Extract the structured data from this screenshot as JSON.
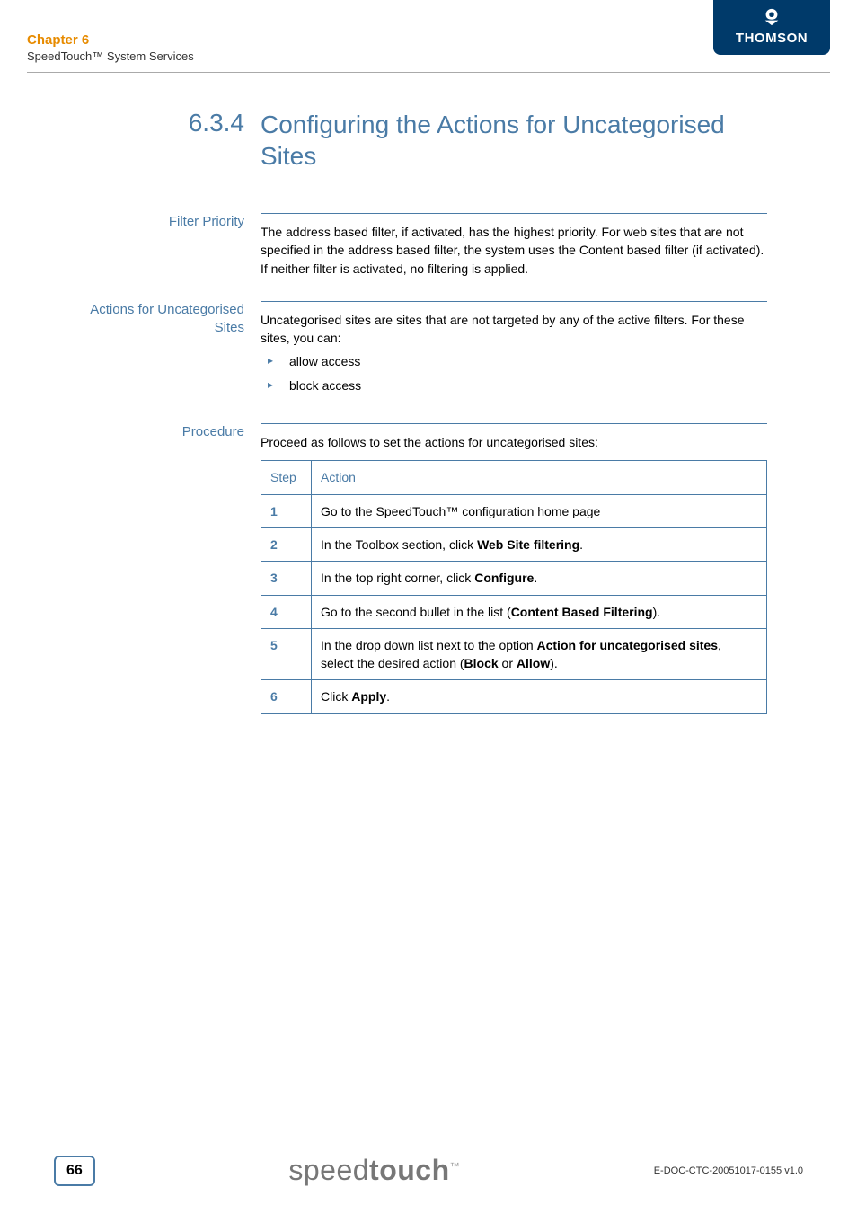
{
  "header": {
    "chapter": "Chapter 6",
    "subtitle": "SpeedTouch™ System Services",
    "brand": "THOMSON"
  },
  "section": {
    "number": "6.3.4",
    "title": "Configuring the Actions for Uncategorised Sites"
  },
  "blocks": {
    "filter_priority": {
      "label": "Filter Priority",
      "text": "The address based filter, if activated, has the highest priority. For web sites that are not specified in the address based filter, the system uses the Content based filter (if activated). If neither filter is activated, no filtering is applied."
    },
    "actions": {
      "label": "Actions for Uncategorised Sites",
      "intro": "Uncategorised sites are sites that are not targeted by any of the active filters. For these sites, you can:",
      "bullets": [
        "allow access",
        "block access"
      ]
    },
    "procedure": {
      "label": "Procedure",
      "intro": "Proceed as follows to set the actions for uncategorised sites:",
      "table": {
        "headers": [
          "Step",
          "Action"
        ],
        "rows": [
          {
            "step": "1",
            "action_html": "Go to the SpeedTouch™ configuration home page"
          },
          {
            "step": "2",
            "action_html": "In the Toolbox section, click <b>Web Site filtering</b>."
          },
          {
            "step": "3",
            "action_html": "In the top right corner, click <b>Configure</b>."
          },
          {
            "step": "4",
            "action_html": "Go to the second bullet in the list (<b>Content Based Filtering</b>)."
          },
          {
            "step": "5",
            "action_html": "In the drop down list next to the option <b>Action for uncategorised sites</b>, select the desired action (<b>Block</b> or <b>Allow</b>)."
          },
          {
            "step": "6",
            "action_html": "Click <b>Apply</b>."
          }
        ]
      }
    }
  },
  "footer": {
    "page": "66",
    "logo_light": "speed",
    "logo_bold": "touch",
    "logo_tm": "™",
    "doc_id": "E-DOC-CTC-20051017-0155 v1.0"
  }
}
